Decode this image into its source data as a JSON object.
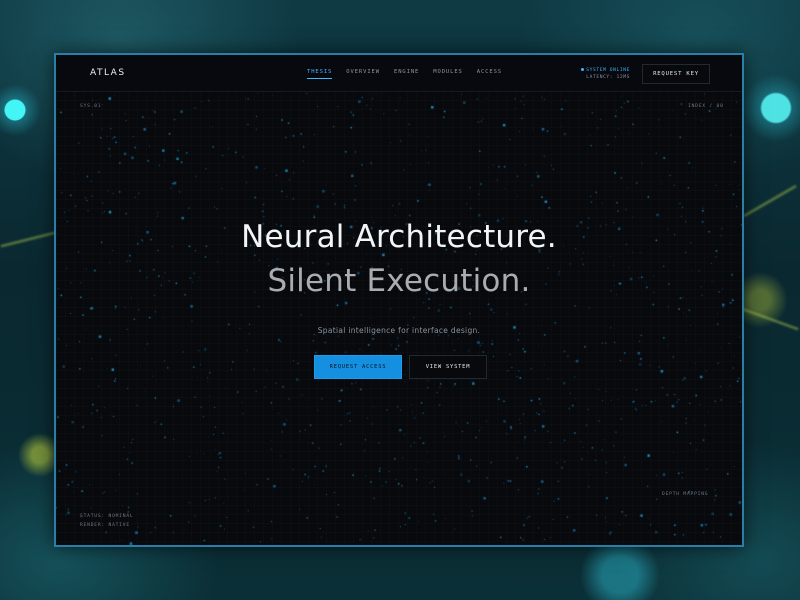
{
  "header": {
    "logo": "ATLAS",
    "nav": [
      {
        "label": "THESIS",
        "active": true
      },
      {
        "label": "OVERVIEW",
        "active": false
      },
      {
        "label": "ENGINE",
        "active": false
      },
      {
        "label": "MODULES",
        "active": false
      },
      {
        "label": "ACCESS",
        "active": false
      }
    ],
    "status_online": "SYSTEM ONLINE",
    "latency": "LATENCY: 12MS",
    "cta_label": "REQUEST KEY"
  },
  "corners": {
    "top_left": "SYS.01",
    "top_right": "INDEX / 00"
  },
  "hero": {
    "line1": "Neural Architecture.",
    "line2": "Silent Execution.",
    "tagline": "Spatial intelligence for interface design.",
    "primary_button": "REQUEST ACCESS",
    "secondary_button": "VIEW SYSTEM"
  },
  "footer": {
    "status": "STATUS: NOMINAL",
    "render": "RENDER: NATIVE",
    "depth": "DEPTH MAPPING"
  },
  "colors": {
    "accent": "#1590e0",
    "accent_text": "#3fb7ff",
    "panel_bg": "#07090d",
    "frame_border": "#2a7fa8"
  }
}
